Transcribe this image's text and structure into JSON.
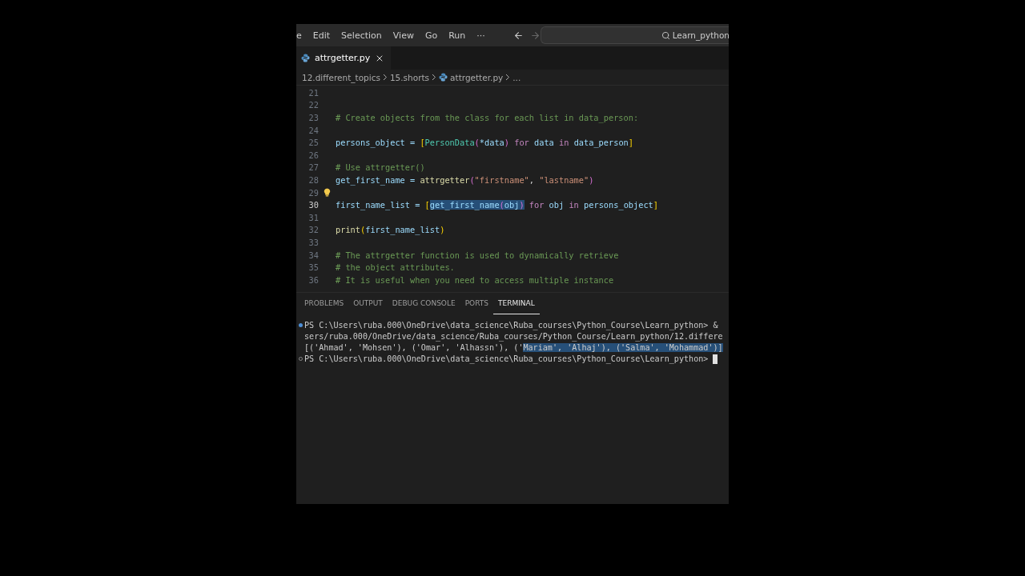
{
  "menu_bar": {
    "items": [
      "e",
      "Edit",
      "Selection",
      "View",
      "Go",
      "Run",
      "···"
    ],
    "nav": [
      {
        "kind": "back",
        "disabled": false
      },
      {
        "kind": "forward",
        "disabled": true
      }
    ],
    "search": {
      "value": "Learn_python"
    }
  },
  "tabs": [
    {
      "label": "attrgetter.py",
      "selected": true
    }
  ],
  "breadcrumb": [
    "12.different_topics",
    "15.shorts",
    "attrgetter.py",
    "..."
  ],
  "editor": {
    "lines": [
      {
        "number": "21",
        "current": false,
        "hint": false
      },
      {
        "number": "22",
        "current": false,
        "hint": false
      },
      {
        "number": "23",
        "current": false,
        "hint": false,
        "tokens": [
          {
            "text": "# Create objects from the class for each list in data_person:",
            "kind": "comment",
            "selected": false
          }
        ]
      },
      {
        "number": "24",
        "current": false,
        "hint": false
      },
      {
        "number": "25",
        "current": false,
        "hint": false,
        "tokens": [
          {
            "text": "persons_object = ",
            "kind": "variable",
            "selected": false
          },
          {
            "text": "[",
            "kind": "bracket",
            "selected": false
          },
          {
            "text": "PersonData",
            "kind": "class",
            "selected": false
          },
          {
            "text": "(",
            "kind": "paren",
            "selected": false
          },
          {
            "text": "*data",
            "kind": "variable",
            "selected": false
          },
          {
            "text": ")",
            "kind": "paren",
            "selected": false
          },
          {
            "text": " for ",
            "kind": "keyword",
            "selected": false
          },
          {
            "text": "data",
            "kind": "variable",
            "selected": false
          },
          {
            "text": " in ",
            "kind": "keyword",
            "selected": false
          },
          {
            "text": "data_person",
            "kind": "variable",
            "selected": false
          },
          {
            "text": "]",
            "kind": "bracket",
            "selected": false
          }
        ]
      },
      {
        "number": "26",
        "current": false,
        "hint": false
      },
      {
        "number": "27",
        "current": false,
        "hint": false,
        "tokens": [
          {
            "text": "# Use attrgetter()",
            "kind": "comment",
            "selected": false
          }
        ]
      },
      {
        "number": "28",
        "current": false,
        "hint": false,
        "tokens": [
          {
            "text": "get_first_name = ",
            "kind": "variable",
            "selected": false
          },
          {
            "text": "attrgetter",
            "kind": "function",
            "selected": false
          },
          {
            "text": "(",
            "kind": "paren",
            "selected": false
          },
          {
            "text": "\"firstname\"",
            "kind": "string",
            "selected": false
          },
          {
            "text": ", ",
            "kind": "plain",
            "selected": false
          },
          {
            "text": "\"lastname\"",
            "kind": "string",
            "selected": false
          },
          {
            "text": ")",
            "kind": "paren",
            "selected": false
          }
        ]
      },
      {
        "number": "29",
        "current": false,
        "hint": true
      },
      {
        "number": "30",
        "current": true,
        "hint": false,
        "tokens": [
          {
            "text": "first_name_list = ",
            "kind": "variable",
            "selected": false
          },
          {
            "text": "[",
            "kind": "bracket",
            "selected": false
          },
          {
            "text": "get_first_name",
            "kind": "variable",
            "selected": true
          },
          {
            "text": "(",
            "kind": "paren",
            "selected": true
          },
          {
            "text": "obj",
            "kind": "variable",
            "selected": true
          },
          {
            "text": ")",
            "kind": "paren",
            "selected": true
          },
          {
            "text": " for ",
            "kind": "keyword",
            "selected": false
          },
          {
            "text": "obj",
            "kind": "variable",
            "selected": false
          },
          {
            "text": " in ",
            "kind": "keyword",
            "selected": false
          },
          {
            "text": "persons_object",
            "kind": "variable",
            "selected": false
          },
          {
            "text": "]",
            "kind": "bracket",
            "selected": false
          }
        ]
      },
      {
        "number": "31",
        "current": false,
        "hint": false
      },
      {
        "number": "32",
        "current": false,
        "hint": false,
        "tokens": [
          {
            "text": "print",
            "kind": "function",
            "selected": false
          },
          {
            "text": "(",
            "kind": "bracket",
            "selected": false
          },
          {
            "text": "first_name_list",
            "kind": "variable",
            "selected": false
          },
          {
            "text": ")",
            "kind": "bracket",
            "selected": false
          }
        ]
      },
      {
        "number": "33",
        "current": false,
        "hint": false
      },
      {
        "number": "34",
        "current": false,
        "hint": false,
        "tokens": [
          {
            "text": "# The attrgetter function is used to dynamically retrieve",
            "kind": "comment",
            "selected": false
          }
        ]
      },
      {
        "number": "35",
        "current": false,
        "hint": false,
        "tokens": [
          {
            "text": "# the object attributes.",
            "kind": "comment",
            "selected": false
          }
        ]
      },
      {
        "number": "36",
        "current": false,
        "hint": false,
        "tokens": [
          {
            "text": "# It is useful when you need to access multiple instance",
            "kind": "comment",
            "selected": false
          }
        ]
      }
    ]
  },
  "panel": {
    "tabs": [
      {
        "label": "PROBLEMS",
        "selected": false
      },
      {
        "label": "OUTPUT",
        "selected": false
      },
      {
        "label": "DEBUG CONSOLE",
        "selected": false
      },
      {
        "label": "PORTS",
        "selected": false
      },
      {
        "label": "TERMINAL",
        "selected": true
      }
    ],
    "terminal": [
      {
        "kind": "command",
        "cursor": false,
        "segments": [
          {
            "text": "PS C:\\Users\\ruba.000\\OneDrive\\data_science\\Ruba_courses\\Python_Course\\Learn_python> &",
            "selected": false
          }
        ]
      },
      {
        "kind": "output",
        "cursor": false,
        "segments": [
          {
            "text": "sers/ruba.000/OneDrive/data_science/Ruba_courses/Python_Course/Learn_python/12.differe",
            "selected": false
          }
        ]
      },
      {
        "kind": "output",
        "cursor": false,
        "segments": [
          {
            "text": "[('Ahmad', 'Mohsen'), ('Omar', 'Alhassn'), ('",
            "selected": false
          },
          {
            "text": "Mariam', 'Alhaj'), ('Salma', 'Mohammad')]",
            "selected": true
          }
        ]
      },
      {
        "kind": "prompt",
        "cursor": true,
        "segments": [
          {
            "text": "PS C:\\Users\\ruba.000\\OneDrive\\data_science\\Ruba_courses\\Python_Course\\Learn_python>",
            "selected": false
          }
        ]
      }
    ]
  }
}
